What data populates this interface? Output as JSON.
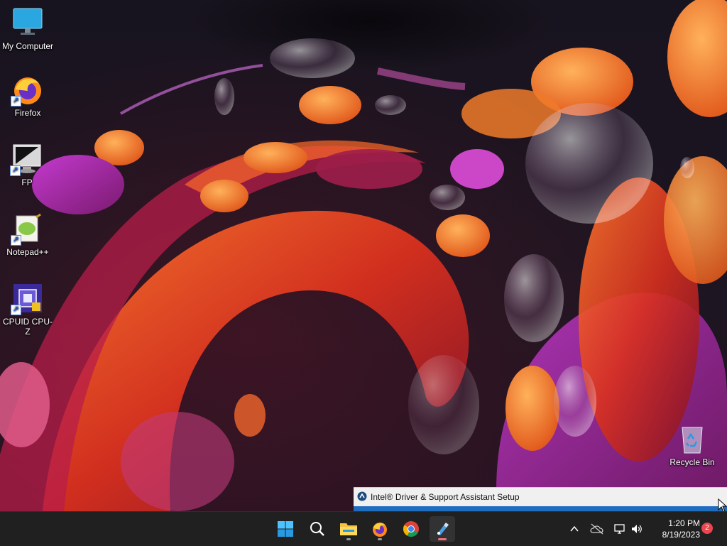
{
  "desktop": {
    "icons": [
      {
        "label": "My Computer",
        "icon": "monitor-icon"
      },
      {
        "label": "Firefox",
        "icon": "firefox-icon"
      },
      {
        "label": "FP",
        "icon": "fp-monitor-icon"
      },
      {
        "label": "Notepad++",
        "icon": "notepadpp-icon"
      },
      {
        "label": "CPUID CPU-Z",
        "icon": "cpuz-icon"
      },
      {
        "label": "Recycle Bin",
        "icon": "recycle-bin-icon"
      }
    ]
  },
  "installer": {
    "title": "Intel® Driver & Support Assistant Setup",
    "icon": "intel-dsa-icon"
  },
  "taskbar": {
    "apps": [
      {
        "name": "Start",
        "icon": "windows-start-icon"
      },
      {
        "name": "Search",
        "icon": "search-icon"
      },
      {
        "name": "File Explorer",
        "icon": "folder-icon"
      },
      {
        "name": "Firefox",
        "icon": "firefox-icon"
      },
      {
        "name": "Chrome",
        "icon": "chrome-icon"
      },
      {
        "name": "Intel Driver & Support Assistant",
        "icon": "intel-dsa-icon"
      }
    ],
    "tray": {
      "icons": [
        "chevron-up-icon",
        "onedrive-offline-icon",
        "network-icon",
        "volume-icon"
      ],
      "time": "1:20 PM",
      "date": "8/19/2023",
      "notification_count": "2"
    }
  },
  "colors": {
    "taskbar_bg": "#202020",
    "installer_progress": "#1f6dbf",
    "active_indicator": "#f1707a",
    "badge": "#e8474f"
  }
}
